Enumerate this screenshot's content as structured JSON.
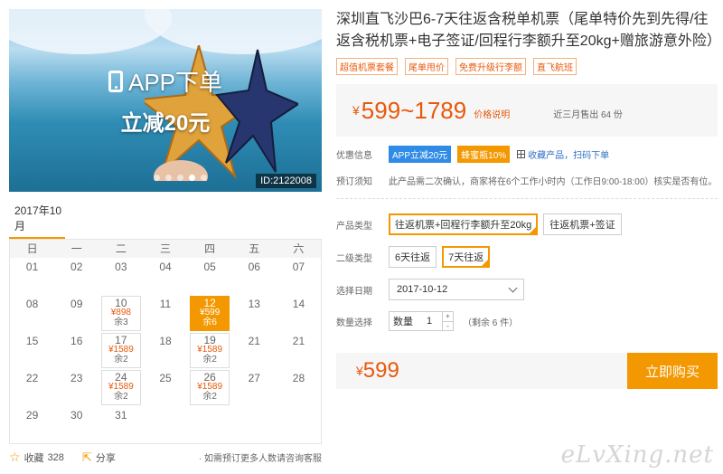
{
  "banner": {
    "app_line": "APP下单",
    "discount_line": "立减20元",
    "id_tag": "ID:2122008",
    "dots": 5,
    "active_dot": 3
  },
  "calendar": {
    "month": "2017年10月",
    "weekdays": [
      "日",
      "一",
      "二",
      "三",
      "四",
      "五",
      "六"
    ],
    "rows": [
      [
        {
          "d": "01"
        },
        {
          "d": "02"
        },
        {
          "d": "03"
        },
        {
          "d": "04"
        },
        {
          "d": "05"
        },
        {
          "d": "06"
        },
        {
          "d": "07"
        }
      ],
      [
        {
          "d": "08"
        },
        {
          "d": "09"
        },
        {
          "d": "10",
          "p": "¥898",
          "r": "余3"
        },
        {
          "d": "11"
        },
        {
          "d": "12",
          "p": "¥599",
          "r": "余6",
          "sel": true
        },
        {
          "d": "13"
        },
        {
          "d": "14"
        }
      ],
      [
        {
          "d": "15"
        },
        {
          "d": "16"
        },
        {
          "d": "17",
          "p": "¥1589",
          "r": "余2"
        },
        {
          "d": "18"
        },
        {
          "d": "19",
          "p": "¥1589",
          "r": "余2"
        },
        {
          "d": "21"
        },
        {
          "d": "21"
        }
      ],
      [
        {
          "d": "22"
        },
        {
          "d": "23"
        },
        {
          "d": "24",
          "p": "¥1589",
          "r": "余2"
        },
        {
          "d": "25"
        },
        {
          "d": "26",
          "p": "¥1589",
          "r": "余2"
        },
        {
          "d": "27"
        },
        {
          "d": "28"
        }
      ],
      [
        {
          "d": "29"
        },
        {
          "d": "30"
        },
        {
          "d": "31"
        },
        {
          "d": ""
        },
        {
          "d": ""
        },
        {
          "d": ""
        },
        {
          "d": ""
        }
      ]
    ]
  },
  "footer": {
    "fav_label": "收藏",
    "fav_count": "328",
    "share_label": "分享",
    "tip": "· 如需预订更多人数请咨询客服"
  },
  "product": {
    "title": "深圳直飞沙巴6-7天往返含税单机票（尾单特价先到先得/往返含税机票+电子签证/回程行李额升至20kg+赠旅游意外险）",
    "tags": [
      "超值机票套餐",
      "尾单甩价",
      "免费升级行李额",
      "直飞航班"
    ],
    "currency": "¥",
    "price_range": "599~1789",
    "price_explain": "价格说明",
    "sold": "近三月售出 64 份",
    "promo_label": "优惠信息",
    "promo_badges": [
      "APP立减20元",
      "蜂蜜瓶10%"
    ],
    "app_link": "收藏产品，扫码下单",
    "notice_label": "预订须知",
    "notice_text": "此产品需二次确认，商家将在6个工作小时内（工作日9:00-18:00）核实是否有位。",
    "type_label": "产品类型",
    "types": [
      "往返机票+回程行李额升至20kg",
      "往返机票+签证"
    ],
    "level2_label": "二级类型",
    "level2": [
      "6天往返",
      "7天往返"
    ],
    "date_label": "选择日期",
    "date_value": "2017-10-12",
    "qty_label": "数量选择",
    "qty_inner_label": "数量",
    "qty_value": "1",
    "remain": "（剩余 6 件）",
    "final_price": "599",
    "buy_label": "立即购买"
  },
  "watermark": "eLvXing.net"
}
